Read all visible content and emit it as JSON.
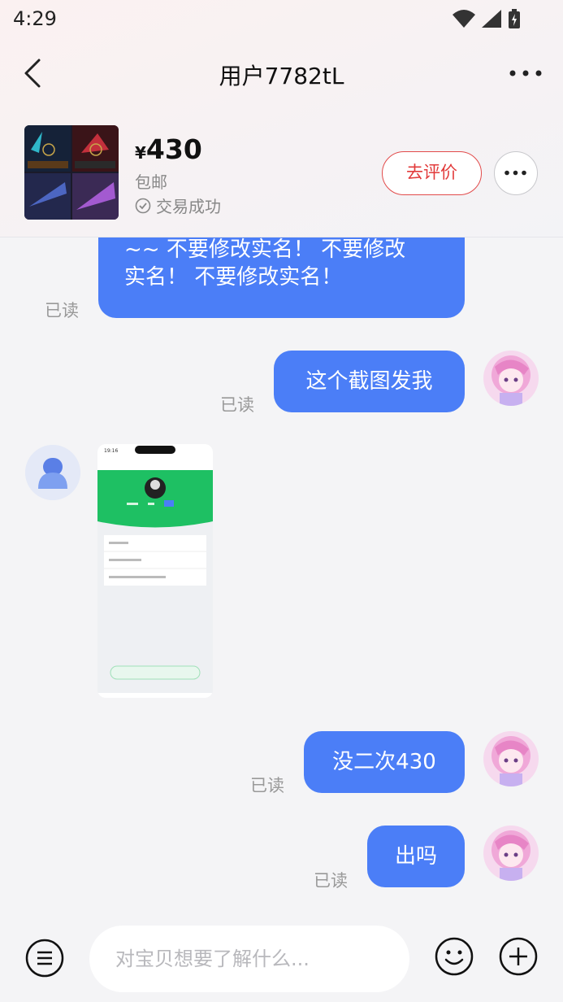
{
  "status": {
    "time": "4:29"
  },
  "nav": {
    "title": "用户7782tL"
  },
  "product": {
    "currency": "¥",
    "price": "430",
    "shipping": "包邮",
    "trade_status": "交易成功",
    "rate_label": "去评价"
  },
  "messages": [
    {
      "side": "left",
      "text": "截图发我\n~~ 不要修改实名！ 不要修改\n实名！ 不要修改实名！",
      "read": "已读"
    },
    {
      "side": "right",
      "text": "这个截图发我",
      "read": "已读"
    },
    {
      "side": "left",
      "type": "image"
    },
    {
      "side": "right",
      "text": "没二次430",
      "read": "已读"
    },
    {
      "side": "right",
      "text": "出吗",
      "read": "已读"
    }
  ],
  "input": {
    "placeholder": "对宝贝想要了解什么..."
  },
  "colors": {
    "bubble": "#4b7ef7",
    "accent_red": "#e23b3b",
    "bg": "#f4f4f6"
  }
}
